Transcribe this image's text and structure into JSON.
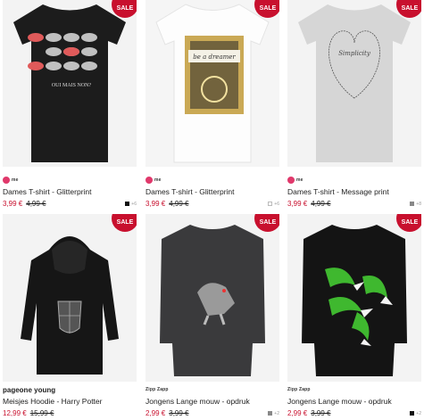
{
  "products": [
    {
      "brand": "me",
      "title": "Dames T-shirt - Glitterprint",
      "price": "3,99 €",
      "old_price": "4,99 €",
      "sale": "SALE",
      "swatch_color": "#111111",
      "more": "+6",
      "print_text": "OUI MAIS NON?"
    },
    {
      "brand": "me",
      "title": "Dames T-shirt - Glitterprint",
      "price": "3,99 €",
      "old_price": "4,99 €",
      "sale": "SALE",
      "swatch_color": "#ffffff",
      "more": "+6",
      "print_text": "be a dreamer"
    },
    {
      "brand": "me",
      "title": "Dames T-shirt - Message print",
      "price": "3,99 €",
      "old_price": "4,99 €",
      "sale": "SALE",
      "swatch_color": "#888888",
      "more": "+8",
      "print_text": "Simplicity"
    },
    {
      "brand": "pageone young",
      "title": "Meisjes Hoodie - Harry Potter",
      "price": "12,99 €",
      "old_price": "15,99 €",
      "sale": "SALE",
      "swatch_color": "",
      "more": ""
    },
    {
      "brand": "Zipp Zapp",
      "title": "Jongens Lange mouw - opdruk",
      "price": "2,99 €",
      "old_price": "3,99 €",
      "sale": "SALE",
      "swatch_color": "#888888",
      "more": "+2"
    },
    {
      "brand": "Zipp Zapp",
      "title": "Jongens Lange mouw - opdruk",
      "price": "2,99 €",
      "old_price": "3,99 €",
      "sale": "SALE",
      "swatch_color": "#111111",
      "more": "+2"
    }
  ]
}
